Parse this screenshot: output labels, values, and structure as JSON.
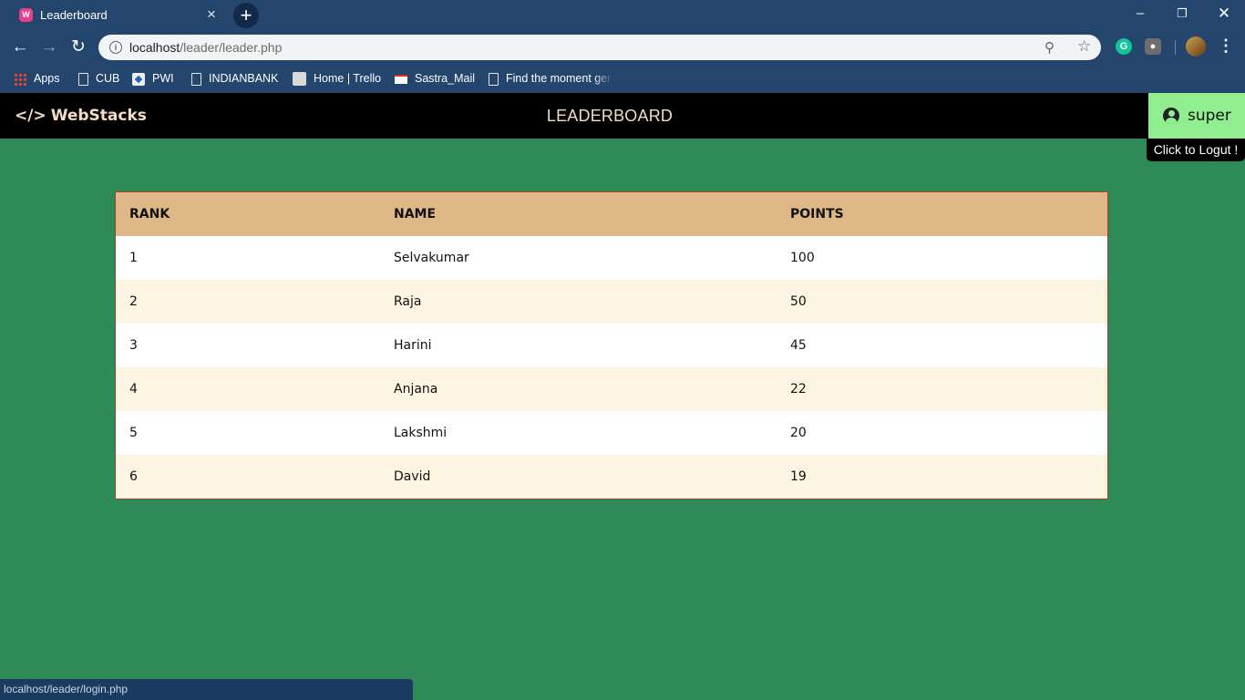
{
  "browser": {
    "tab_title": "Leaderboard",
    "url_host": "localhost",
    "url_path": "/leader/leader.php",
    "status_url": "localhost/leader/login.php",
    "bookmarks": [
      {
        "label": "Apps"
      },
      {
        "label": "CUB"
      },
      {
        "label": "PWI"
      },
      {
        "label": "INDIANBANK"
      },
      {
        "label": "Home | Trello"
      },
      {
        "label": "Sastra_Mail"
      },
      {
        "label": "Find the moment gen"
      }
    ]
  },
  "header": {
    "brand": "WebStacks",
    "title": "LEADERBOARD",
    "username": "super",
    "logout_tooltip": "Click to Logut !"
  },
  "leaderboard": {
    "columns": [
      "RANK",
      "NAME",
      "POINTS"
    ],
    "rows": [
      {
        "rank": "1",
        "name": "Selvakumar",
        "points": "100"
      },
      {
        "rank": "2",
        "name": "Raja",
        "points": "50"
      },
      {
        "rank": "3",
        "name": "Harini",
        "points": "45"
      },
      {
        "rank": "4",
        "name": "Anjana",
        "points": "22"
      },
      {
        "rank": "5",
        "name": "Lakshmi",
        "points": "20"
      },
      {
        "rank": "6",
        "name": "David",
        "points": "19"
      }
    ]
  },
  "colors": {
    "page_bg": "#2e8b57",
    "header_bg": "#000000",
    "table_head": "#deb887",
    "user_box": "#90ee90",
    "chrome": "#24456c"
  }
}
